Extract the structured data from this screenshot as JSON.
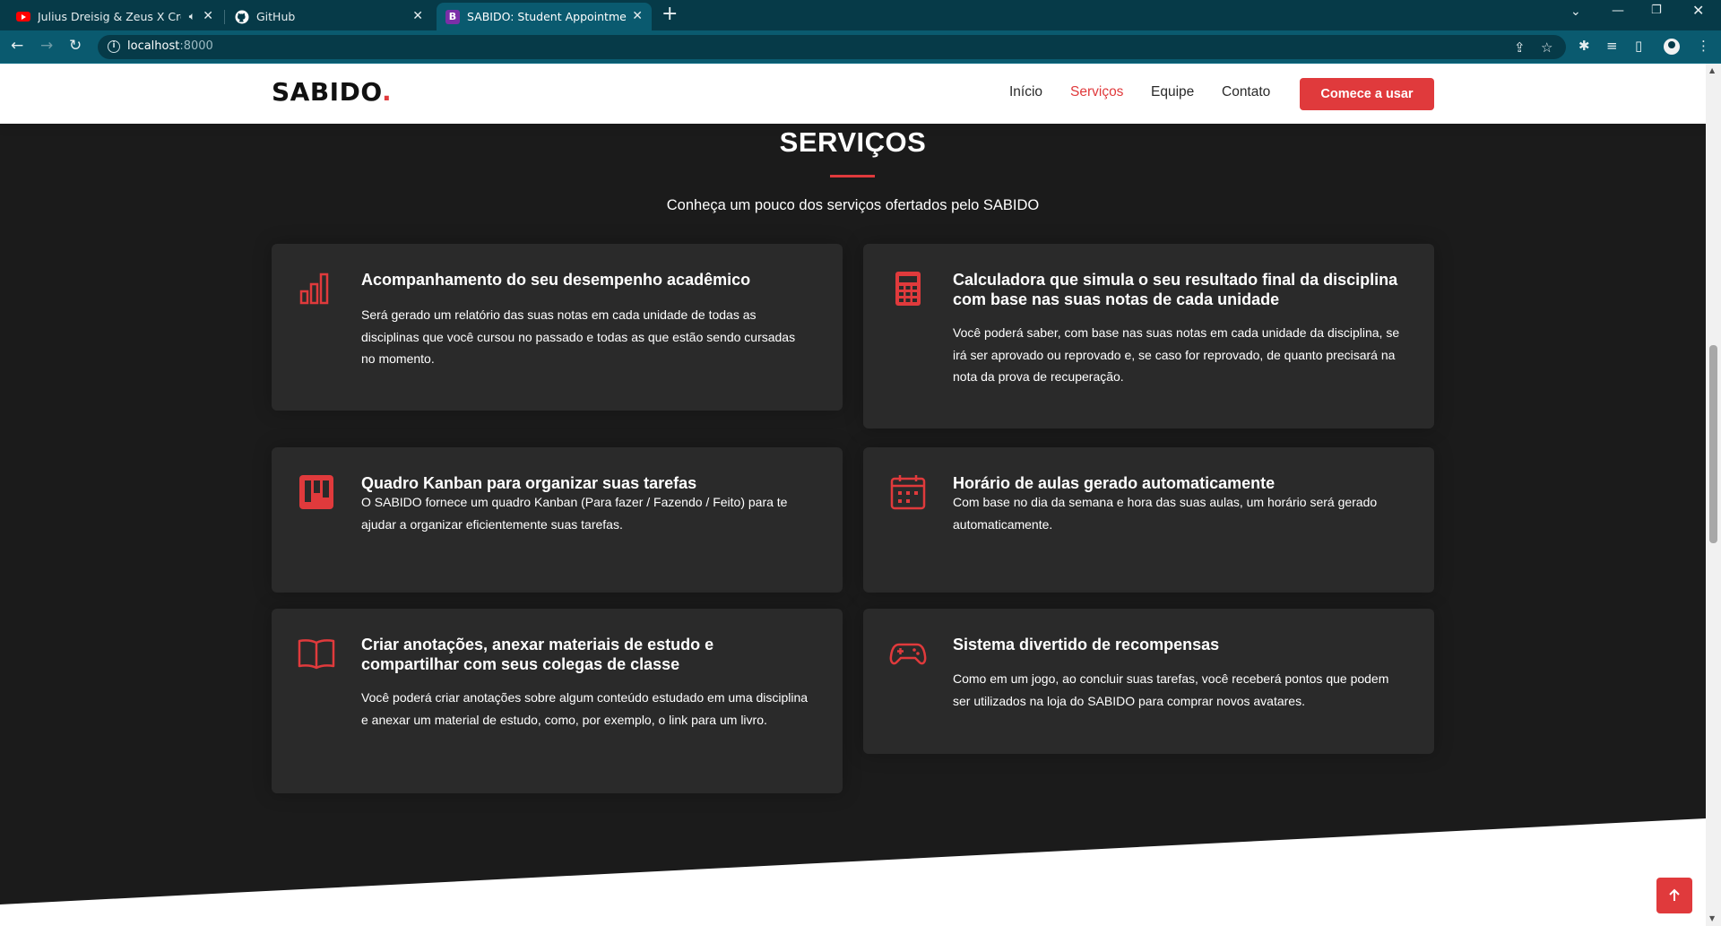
{
  "browser": {
    "tabs": [
      {
        "title": "Julius Dreisig & Zeus X Crona",
        "icon": "youtube-icon",
        "audio": true
      },
      {
        "title": "GitHub",
        "icon": "github-icon"
      },
      {
        "title": "SABIDO: Student Appointment B",
        "icon": "bootstrap-icon",
        "active": true
      }
    ],
    "new_tab_label": "+",
    "url_host": "localhost",
    "url_port": ":8000"
  },
  "site": {
    "logo_text": "SABIDO",
    "logo_dot": ".",
    "nav": [
      {
        "label": "Início"
      },
      {
        "label": "Serviços",
        "active": true
      },
      {
        "label": "Equipe"
      },
      {
        "label": "Contato"
      }
    ],
    "cta_label": "Comece a usar"
  },
  "services": {
    "title": "SERVIÇOS",
    "subtitle": "Conheça um pouco dos serviços ofertados pelo SABIDO",
    "cards": [
      {
        "icon": "bar-chart-icon",
        "title": "Acompanhamento do seu desempenho acadêmico",
        "text": "Será gerado um relatório das suas notas em cada unidade de todas as disciplinas que você cursou no passado e todas as que estão sendo cursadas no momento."
      },
      {
        "icon": "calculator-icon",
        "title": "Calculadora que simula o seu resultado final da disciplina com base nas suas notas de cada unidade",
        "text": "Você poderá saber, com base nas suas notas em cada unidade da disciplina, se irá ser aprovado ou reprovado e, se caso for reprovado, de quanto precisará na nota da prova de recuperação."
      },
      {
        "icon": "kanban-icon",
        "title": "Quadro Kanban para organizar suas tarefas",
        "text": "O SABIDO fornece um quadro Kanban (Para fazer / Fazendo / Feito) para te ajudar a organizar eficientemente suas tarefas."
      },
      {
        "icon": "calendar-icon",
        "title": "Horário de aulas gerado automaticamente",
        "text": "Com base no dia da semana e hora das suas aulas, um horário será gerado automaticamente."
      },
      {
        "icon": "book-icon",
        "title": "Criar anotações, anexar materiais de estudo e compartilhar com seus colegas de classe",
        "text": "Você poderá criar anotações sobre algum conteúdo estudado em uma disciplina e anexar um material de estudo, como, por exemplo, o link para um livro."
      },
      {
        "icon": "gamepad-icon",
        "title": "Sistema divertido de recompensas",
        "text": "Como em um jogo, ao concluir suas tarefas, você receberá pontos que podem ser utilizados na loja do SABIDO para comprar novos avatares."
      }
    ]
  },
  "back_to_top_icon": "arrow-up-icon",
  "colors": {
    "accent": "#e03a3c",
    "section_bg": "#1b1b1b",
    "card_bg": "#2a2a2a",
    "browser_frame": "#063a48"
  }
}
